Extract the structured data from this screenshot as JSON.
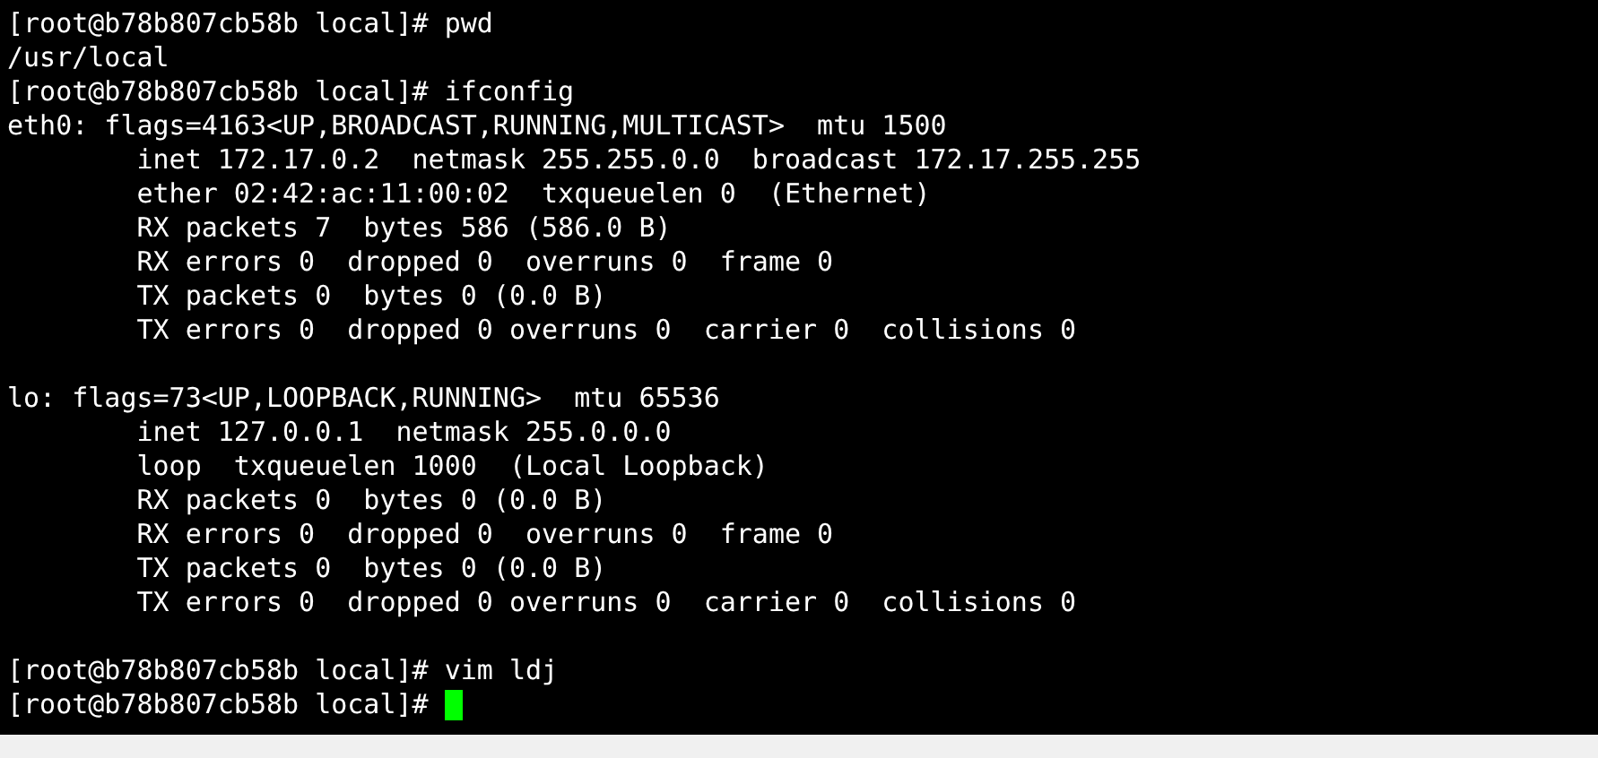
{
  "terminal": {
    "lines": [
      {
        "kind": "text",
        "text": "[root@b78b807cb58b local]# pwd"
      },
      {
        "kind": "text",
        "text": "/usr/local"
      },
      {
        "kind": "text",
        "text": "[root@b78b807cb58b local]# ifconfig"
      },
      {
        "kind": "text",
        "text": "eth0: flags=4163<UP,BROADCAST,RUNNING,MULTICAST>  mtu 1500"
      },
      {
        "kind": "text",
        "text": "        inet 172.17.0.2  netmask 255.255.0.0  broadcast 172.17.255.255"
      },
      {
        "kind": "text",
        "text": "        ether 02:42:ac:11:00:02  txqueuelen 0  (Ethernet)"
      },
      {
        "kind": "text",
        "text": "        RX packets 7  bytes 586 (586.0 B)"
      },
      {
        "kind": "text",
        "text": "        RX errors 0  dropped 0  overruns 0  frame 0"
      },
      {
        "kind": "text",
        "text": "        TX packets 0  bytes 0 (0.0 B)"
      },
      {
        "kind": "text",
        "text": "        TX errors 0  dropped 0 overruns 0  carrier 0  collisions 0"
      },
      {
        "kind": "blank"
      },
      {
        "kind": "text",
        "text": "lo: flags=73<UP,LOOPBACK,RUNNING>  mtu 65536"
      },
      {
        "kind": "text",
        "text": "        inet 127.0.0.1  netmask 255.0.0.0"
      },
      {
        "kind": "text",
        "text": "        loop  txqueuelen 1000  (Local Loopback)"
      },
      {
        "kind": "text",
        "text": "        RX packets 0  bytes 0 (0.0 B)"
      },
      {
        "kind": "text",
        "text": "        RX errors 0  dropped 0  overruns 0  frame 0"
      },
      {
        "kind": "text",
        "text": "        TX packets 0  bytes 0 (0.0 B)"
      },
      {
        "kind": "text",
        "text": "        TX errors 0  dropped 0 overruns 0  carrier 0  collisions 0"
      },
      {
        "kind": "blank"
      },
      {
        "kind": "text",
        "text": "[root@b78b807cb58b local]# vim ldj"
      }
    ],
    "prompt": "[root@b78b807cb58b local]# "
  }
}
